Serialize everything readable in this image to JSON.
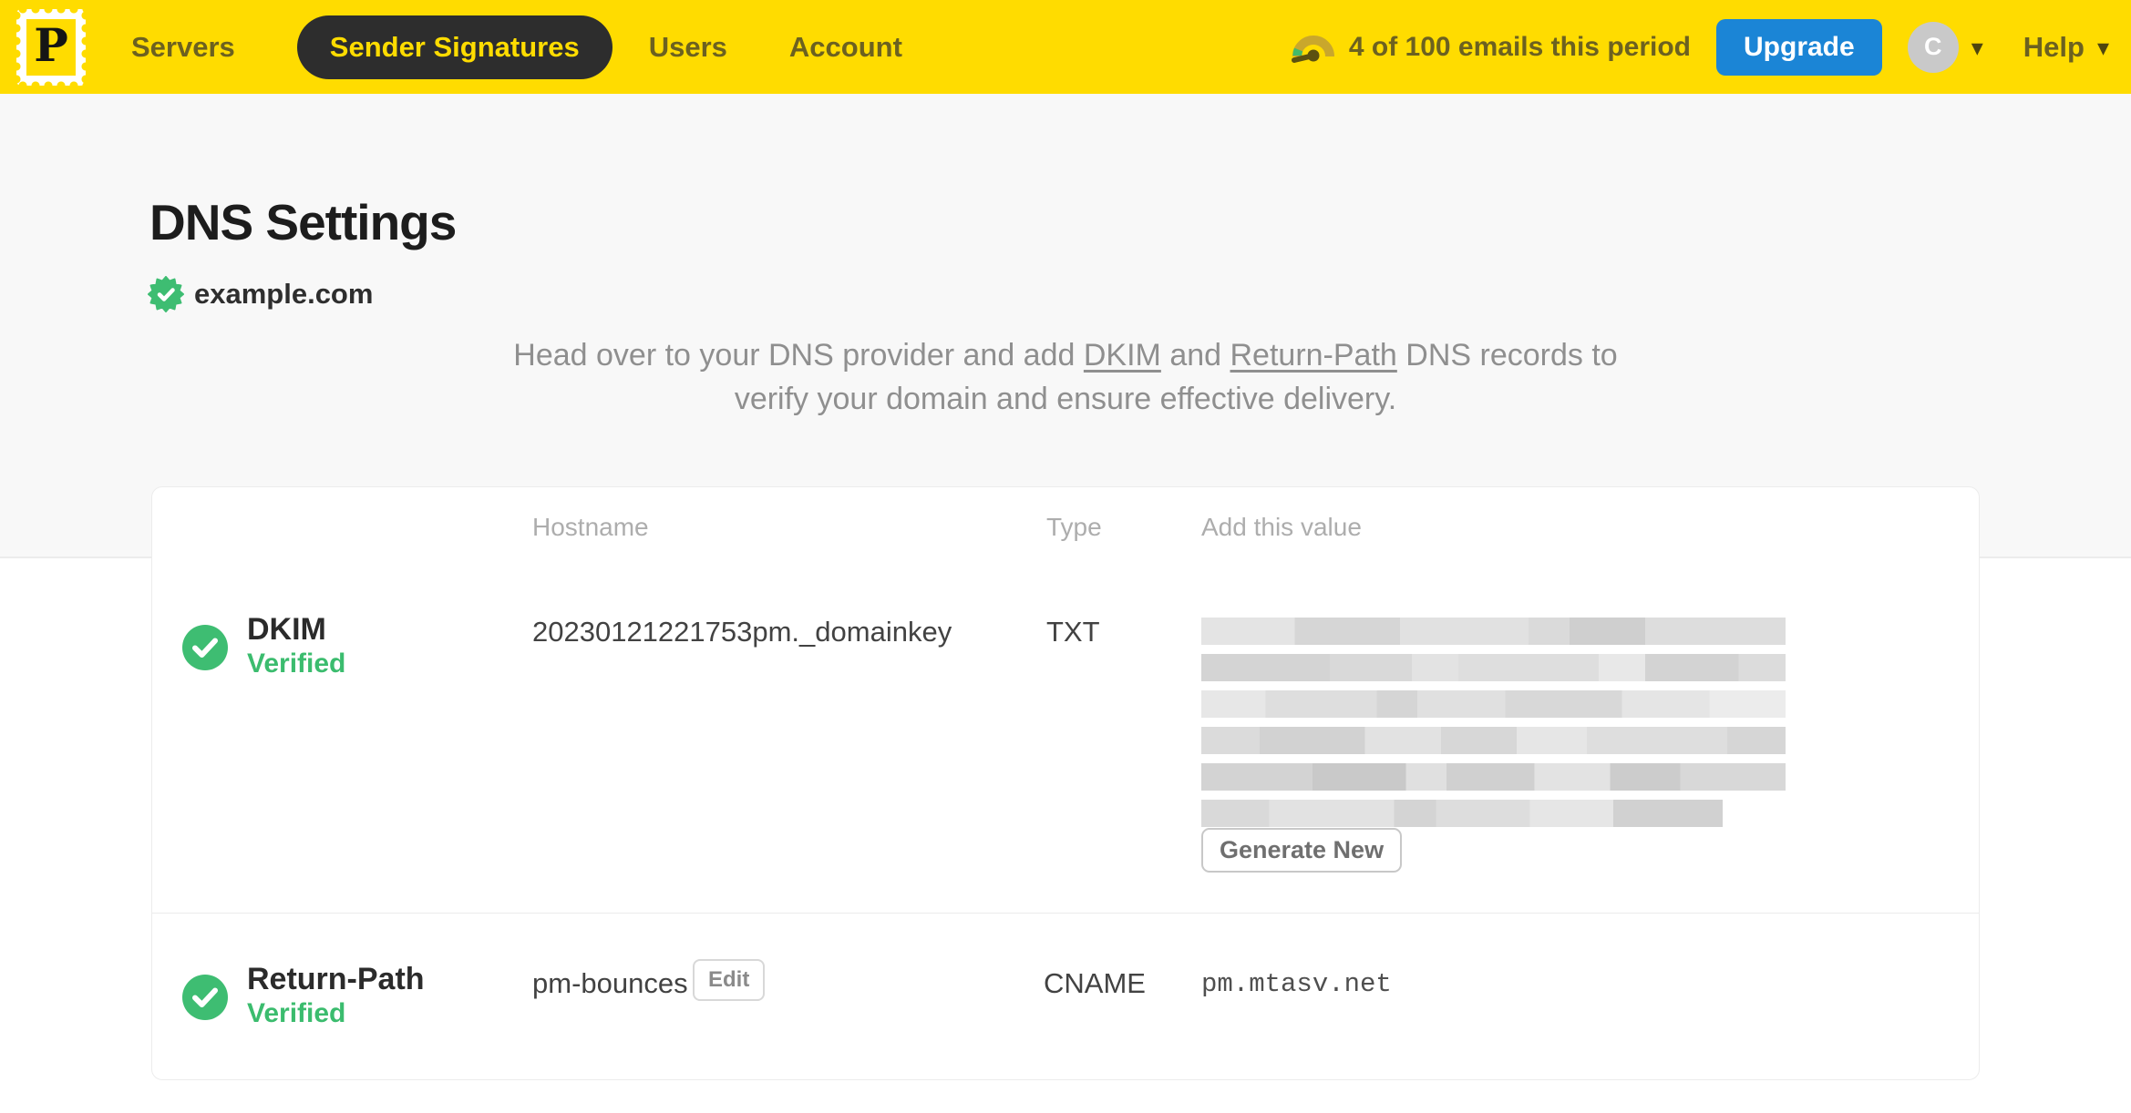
{
  "colors": {
    "brand_yellow": "#ffdc00",
    "nav_text_olive": "#6c6120",
    "active_pill_bg": "#2d2d2d",
    "upgrade_blue": "#1b85d6",
    "verified_green": "#3ebd72",
    "page_bg_gray": "#f8f8f8",
    "border_gray": "#ececec"
  },
  "topbar": {
    "logo": {
      "icon": "postmark-stamp-logo",
      "letter": "P"
    },
    "nav": [
      {
        "label": "Servers",
        "active": false
      },
      {
        "label": "Sender Signatures",
        "active": true
      },
      {
        "label": "Users",
        "active": false
      },
      {
        "label": "Account",
        "active": false
      }
    ],
    "usage": {
      "icon": "gauge-icon",
      "text": "4 of 100 emails this period"
    },
    "upgrade_label": "Upgrade",
    "avatar_initial": "C",
    "help_label": "Help"
  },
  "page": {
    "title": "DNS Settings",
    "domain": {
      "name": "example.com",
      "verified": true
    },
    "description": {
      "prefix": "Head over to your DNS provider and add ",
      "link_dkim": "DKIM",
      "middle": " and ",
      "link_return_path": "Return-Path",
      "suffix": " DNS records to verify your domain and ensure effective delivery."
    }
  },
  "table": {
    "headers": {
      "hostname": "Hostname",
      "type": "Type",
      "value": "Add this value"
    },
    "rows": [
      {
        "name": "DKIM",
        "status": "Verified",
        "hostname": "20230121221753pm._domainkey",
        "type": "TXT",
        "value": {
          "redacted": true,
          "lines": 6
        },
        "action_label": "Generate New"
      },
      {
        "name": "Return-Path",
        "status": "Verified",
        "hostname": "pm-bounces",
        "hostname_action": "Edit",
        "type": "CNAME",
        "value": {
          "redacted": false,
          "text": "pm.mtasv.net"
        }
      }
    ]
  }
}
